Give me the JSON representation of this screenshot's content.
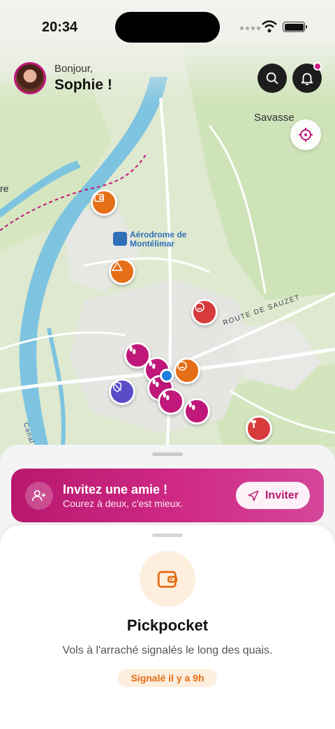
{
  "status_bar": {
    "time": "20:34"
  },
  "header": {
    "greeting": "Bonjour,",
    "name": "Sophie !"
  },
  "map": {
    "labels": {
      "savasse": "Savasse",
      "re": "re",
      "aerodrome": "Aérodrome de",
      "aerodrome2": "Montélimar",
      "route": "ROUTE DE SAUZET",
      "canal": "Canal d"
    }
  },
  "invite": {
    "title": "Invitez une amie !",
    "subtitle": "Courez à deux, c'est mieux.",
    "button_label": "Inviter"
  },
  "incident": {
    "title": "Pickpocket",
    "description": "Vols à l'arraché signalés le long des quais.",
    "badge": "Signalé il y a 9h"
  },
  "colors": {
    "accent": "#c0187a",
    "orange": "#e56f17",
    "red": "#d63a3a",
    "purple": "#5a4cc7",
    "user_location": "#1f7fe0"
  }
}
